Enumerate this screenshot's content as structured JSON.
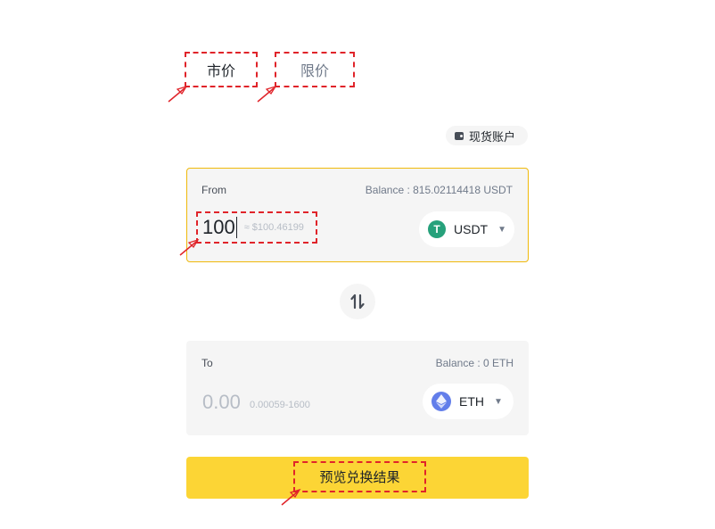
{
  "tabs": {
    "market": "市价",
    "limit": "限价"
  },
  "account": {
    "label": "现货账户",
    "icon": "wallet-icon"
  },
  "from": {
    "label": "From",
    "balance": "Balance : 815.02114418 USDT",
    "amount": "100",
    "approx": "≈ $100.46199",
    "coin": "USDT"
  },
  "to": {
    "label": "To",
    "balance": "Balance : 0 ETH",
    "amount": "0.00",
    "range": "0.00059-1600",
    "coin": "ETH"
  },
  "actions": {
    "preview": "预览兑换结果"
  },
  "colors": {
    "accent": "#fcd535",
    "focus_border": "#f0b90b",
    "annotation": "#e0242a",
    "usdt": "#26a17b",
    "eth": "#627eea"
  }
}
